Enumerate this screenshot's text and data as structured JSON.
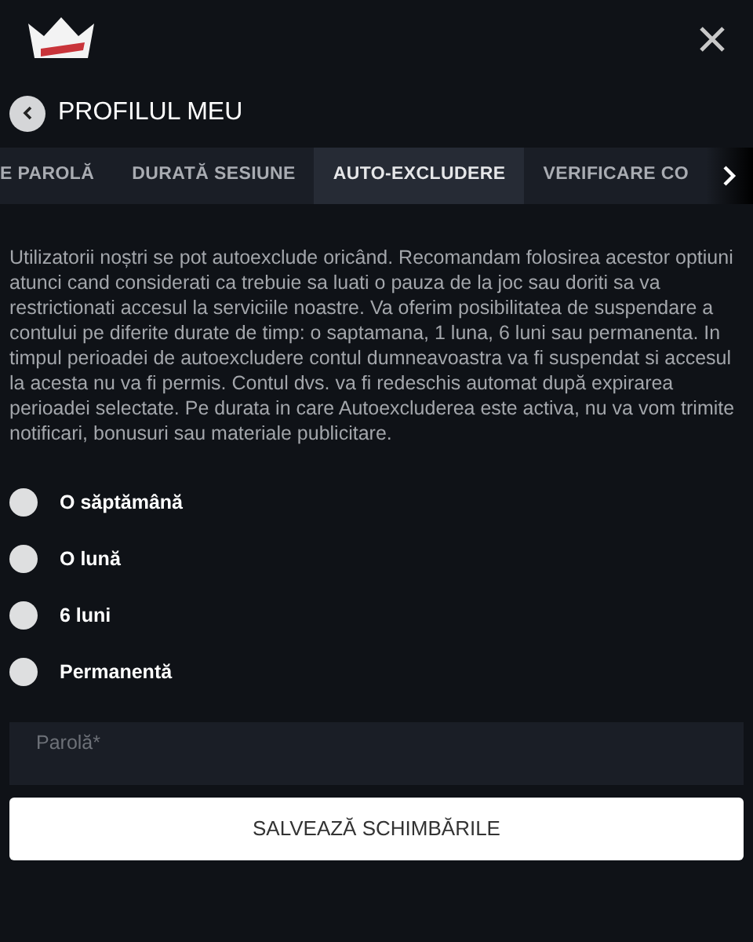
{
  "header": {
    "title": "PROFILUL MEU"
  },
  "tabs": [
    {
      "label": "E PAROLĂ",
      "selected": false
    },
    {
      "label": "DURATĂ SESIUNE",
      "selected": false
    },
    {
      "label": "AUTO-EXCLUDERE",
      "selected": true
    },
    {
      "label": "VERIFICARE CO",
      "selected": false
    }
  ],
  "description": "Utilizatorii noștri se pot autoexclude oricând. Recomandam folosirea acestor optiuni atunci cand considerati ca trebuie sa luati o pauza de la joc sau doriti sa va restrictionati accesul la serviciile noastre. Va oferim posibilitatea de suspendare a contului pe diferite durate de timp: o saptamana, 1 luna, 6 luni sau permanenta. In timpul perioadei de autoexcludere contul dumneavoastra va fi suspendat si accesul la acesta nu va fi permis. Contul dvs. va fi redeschis automat după expirarea perioadei selectate. Pe durata in care Autoexcluderea este activa, nu va vom trimite notificari, bonusuri sau materiale publicitare.",
  "options": [
    {
      "label": "O săptămână",
      "selected": false
    },
    {
      "label": "O lună",
      "selected": false
    },
    {
      "label": "6 luni",
      "selected": false
    },
    {
      "label": "Permanentă",
      "selected": false
    }
  ],
  "password": {
    "placeholder": "Parolă*"
  },
  "save_button": "SALVEAZĂ SCHIMBĂRILE"
}
